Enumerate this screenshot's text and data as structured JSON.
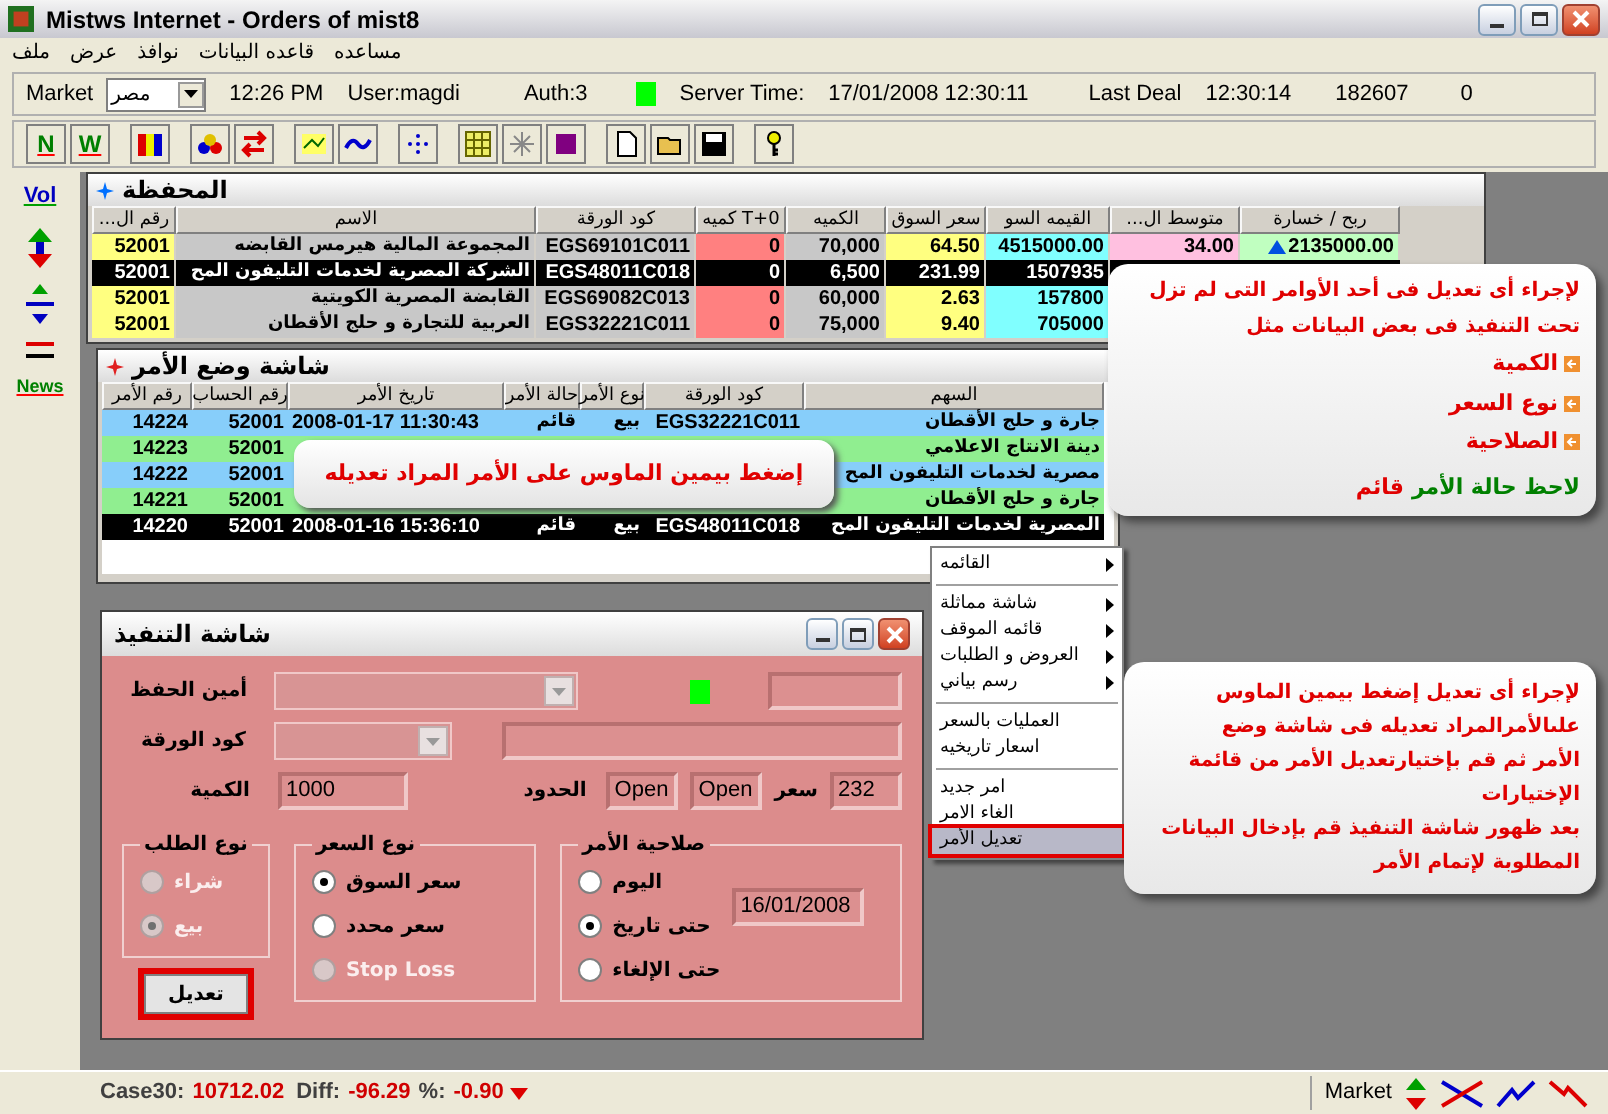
{
  "window": {
    "title": "Mistws Internet - Orders of mist8"
  },
  "menu": [
    "مساعده",
    "قاعده البيانات",
    "نوافذ",
    "عرض",
    "ملف"
  ],
  "info_bar": {
    "market_label": "Market",
    "market_value": "مصر",
    "time": "12:26 PM",
    "user": "User:magdi",
    "auth": "Auth:3",
    "server_label": "Server Time:",
    "server_time": "17/01/2008 12:30:11",
    "last_deal_label": "Last Deal",
    "last_deal_time": "12:30:14",
    "number_1": "182607",
    "number_2": "0"
  },
  "toolbar": {
    "left_letter": "N",
    "right_letter": "W"
  },
  "side_toolbar": {
    "top_label": "Vol",
    "bottom_label": "News"
  },
  "portfolio": {
    "title": "المحفظة",
    "columns": [
      "ربح / خسارة",
      "...متوسط ال",
      "القيمه السو",
      "سعر السوق",
      "الكميه",
      "كميه T+0",
      "كود الورقة",
      "الاسم",
      "...رقم ال"
    ],
    "rows": [
      {
        "account": "52001",
        "name": "المجموعة المالية هيرمس القابضه",
        "code": "EGS69101C011",
        "qty_t0": "0",
        "qty": "70,000",
        "price": "64.50",
        "value": "4515000.00",
        "avg": "34.00",
        "profit": "2135000.00",
        "rising": true,
        "selected": false
      },
      {
        "account": "52001",
        "name": "الشركة المصرية لخدمات التليفون المح",
        "code": "EGS48011C018",
        "qty_t0": "0",
        "qty": "6,500",
        "price": "231.99",
        "value": "1507935",
        "selected": true
      },
      {
        "account": "52001",
        "name": "القابضة المصرية الكويتية",
        "code": "EGS69082C013",
        "qty_t0": "0",
        "qty": "60,000",
        "price": "2.63",
        "value": "157800",
        "selected": false
      },
      {
        "account": "52001",
        "name": "العربية للتجارة و حلج الأقطان",
        "code": "EGS32221C011",
        "qty_t0": "0",
        "qty": "75,000",
        "price": "9.40",
        "value": "705000",
        "selected": false
      }
    ]
  },
  "orders": {
    "title": "شاشة وضع الأمر",
    "columns": [
      "السهم",
      "كود الورقة",
      "نوع الأمر",
      "حالة الأمر",
      "تاريخ الأمر",
      "رقم الحساب",
      "رقم الأمر"
    ],
    "rows": [
      {
        "order_no": "14224",
        "account": "52001",
        "date": "2008-01-17 11:30:43",
        "status": "قائم",
        "type": "بيع",
        "code": "EGS32221C011",
        "stock": "جارة و حلج الأقطان",
        "selected": false
      },
      {
        "order_no": "14223",
        "account": "52001",
        "stock": "دينة الانتاج الاعلامي",
        "selected": false
      },
      {
        "order_no": "14222",
        "account": "52001",
        "stock": "مصرية لخدمات التليفون المح",
        "selected": false
      },
      {
        "order_no": "14221",
        "account": "52001",
        "stock": "جارة و حلج الأقطان",
        "selected": false
      },
      {
        "order_no": "14220",
        "account": "52001",
        "date": "2008-01-16 15:36:10",
        "status": "قائم",
        "type": "بيع",
        "code": "EGS48011C018",
        "stock": "المصرية لخدمات التليفون المح",
        "selected": true
      }
    ],
    "tooltip": "إضغط بيمين الماوس على الأمر المراد تعديله"
  },
  "context_menu": [
    {
      "label": "القائمه",
      "kind": "submenu",
      "selected": false
    },
    {
      "kind": "separator"
    },
    {
      "label": "شاشة مماثلة",
      "kind": "submenu",
      "selected": false
    },
    {
      "label": "قائمه الموقف",
      "kind": "submenu",
      "selected": false
    },
    {
      "label": "العروض و الطلبات",
      "kind": "submenu",
      "selected": false
    },
    {
      "label": "رسم بياني",
      "kind": "submenu",
      "selected": false
    },
    {
      "kind": "separator"
    },
    {
      "label": "العمليات بالسعر",
      "kind": "item",
      "selected": false
    },
    {
      "label": "اسعار تاريخيه",
      "kind": "item",
      "selected": false
    },
    {
      "kind": "separator"
    },
    {
      "label": "امر جديد",
      "kind": "item",
      "selected": false
    },
    {
      "label": "الغاء الامر",
      "kind": "item",
      "selected": false
    },
    {
      "label": "تعديل الأمر",
      "kind": "item",
      "selected": true
    }
  ],
  "execution": {
    "title": "شاشة التنفيذ",
    "custodian_label": "أمين الحفظ",
    "code_label": "كود الورقة",
    "quantity_label": "الكمية",
    "quantity": "1000",
    "limits_label": "الحدود",
    "limit_1": "Open",
    "limit_2": "Open",
    "price_label": "سعر",
    "price": "232",
    "order_side": {
      "title": "نوع الطلب",
      "options": [
        {
          "label": "شراء",
          "checked": false,
          "disabled": true
        },
        {
          "label": "بيع",
          "checked": true,
          "disabled": true
        }
      ]
    },
    "price_type": {
      "title": "نوع السعر",
      "options": [
        {
          "label": "سعر السوق",
          "checked": true,
          "disabled": false
        },
        {
          "label": "سعر محدد",
          "checked": false,
          "disabled": false
        },
        {
          "label": "Stop Loss",
          "checked": false,
          "disabled": true
        }
      ]
    },
    "validity": {
      "title": "صلاحية الأمر",
      "date": "16/01/2008",
      "options": [
        {
          "label": "اليوم",
          "checked": false,
          "disabled": false
        },
        {
          "label": "حتى تاريخ",
          "checked": true,
          "disabled": false
        },
        {
          "label": "حتى الإلغاء",
          "checked": false,
          "disabled": false
        }
      ]
    },
    "button": "تعديل"
  },
  "callout_1": {
    "lines": [
      "لإجراء أى تعديل فى أحد الأوامر التى لم تزل",
      "تحت التنفيذ فى بعض البيانات مثل"
    ],
    "bullets": [
      "الكمية",
      "نوع السعر",
      "الصلاحية"
    ],
    "note_label": "لاحظ حالة الأمر",
    "note_state": "قائم"
  },
  "callout_2": {
    "lines": [
      "لإجراء أى تعديل إضغط بيمين الماوس",
      "علىالأمرالمراد تعديله فى  شاشة وضع",
      "الأمر ثم قم بإختيارتعديل الأمر من قائمة",
      "الإختيارات",
      "بعد ظهور شاشة التنفيذ قم بإدخال البيانات",
      "المطلوبة لإتمام الأمر"
    ]
  },
  "status_bar": {
    "index_label": "Case30:",
    "index_value": "10712.02",
    "diff_label": "Diff:",
    "diff_value": "-96.29",
    "pct_label": "%:",
    "pct_value": "-0.90",
    "market_label": "Market"
  }
}
